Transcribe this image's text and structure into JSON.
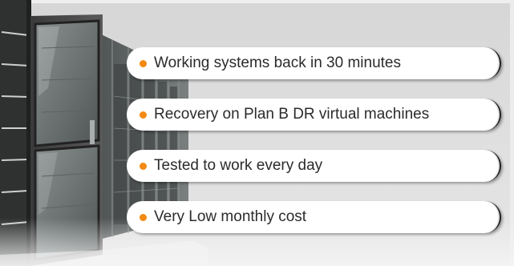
{
  "colors": {
    "bullet": "#f28a14",
    "pill_background": "#ffffff",
    "text": "#2b2b2b",
    "background": "#dedede"
  },
  "features": [
    {
      "label": "Working systems back in 30 minutes"
    },
    {
      "label": "Recovery on Plan B DR virtual machines"
    },
    {
      "label": "Tested to work every day"
    },
    {
      "label": "Very Low monthly cost"
    }
  ]
}
